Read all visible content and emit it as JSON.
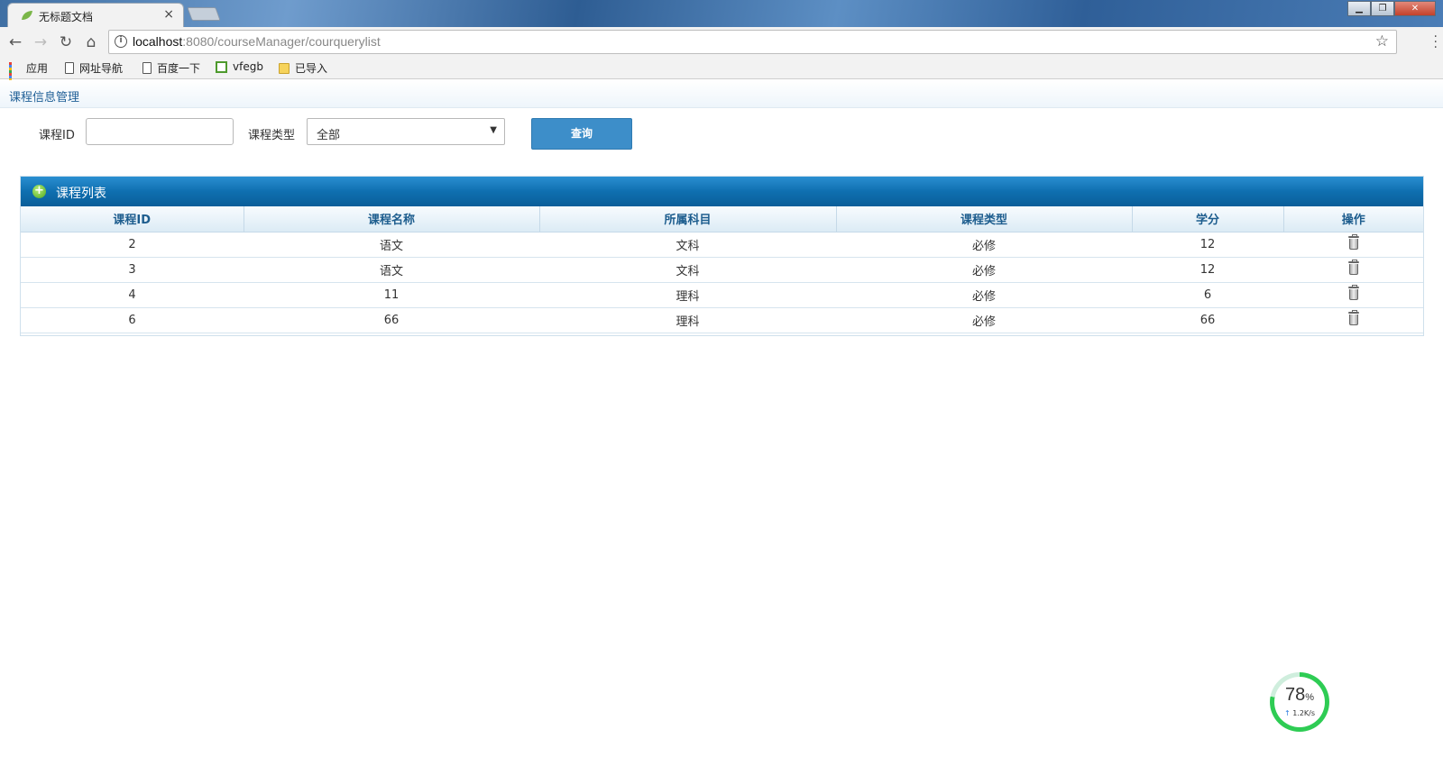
{
  "browser": {
    "tab_title": "无标题文档",
    "tab_close": "×",
    "url_host": "localhost",
    "url_rest": ":8080/courseManager/courquerylist",
    "bookmarks": [
      "应用",
      "网址导航",
      "百度一下",
      "vfegb",
      "已导入"
    ]
  },
  "page": {
    "header_title": "课程信息管理"
  },
  "search": {
    "id_label": "课程ID",
    "id_value": "",
    "type_label": "课程类型",
    "type_selected": "全部",
    "query_button": "查询"
  },
  "panel": {
    "title": "课程列表"
  },
  "table": {
    "columns": [
      "课程ID",
      "课程名称",
      "所属科目",
      "课程类型",
      "学分",
      "操作"
    ],
    "rows": [
      [
        "2",
        "语文",
        "文科",
        "必修",
        "12"
      ],
      [
        "3",
        "语文",
        "文科",
        "必修",
        "12"
      ],
      [
        "4",
        "11",
        "理科",
        "必修",
        "6"
      ],
      [
        "6",
        "66",
        "理科",
        "必修",
        "66"
      ]
    ],
    "row_action_icon": "trash-icon"
  },
  "speed_widget": {
    "percent": "78",
    "percent_unit": "%",
    "rate": "1.2K/s",
    "fill_fraction": 0.78
  },
  "colors": {
    "accent": "#3d8ec9",
    "panel_header": "#0f6fb0",
    "header_text": "#1d5d8e",
    "progress": "#2ecc54"
  }
}
